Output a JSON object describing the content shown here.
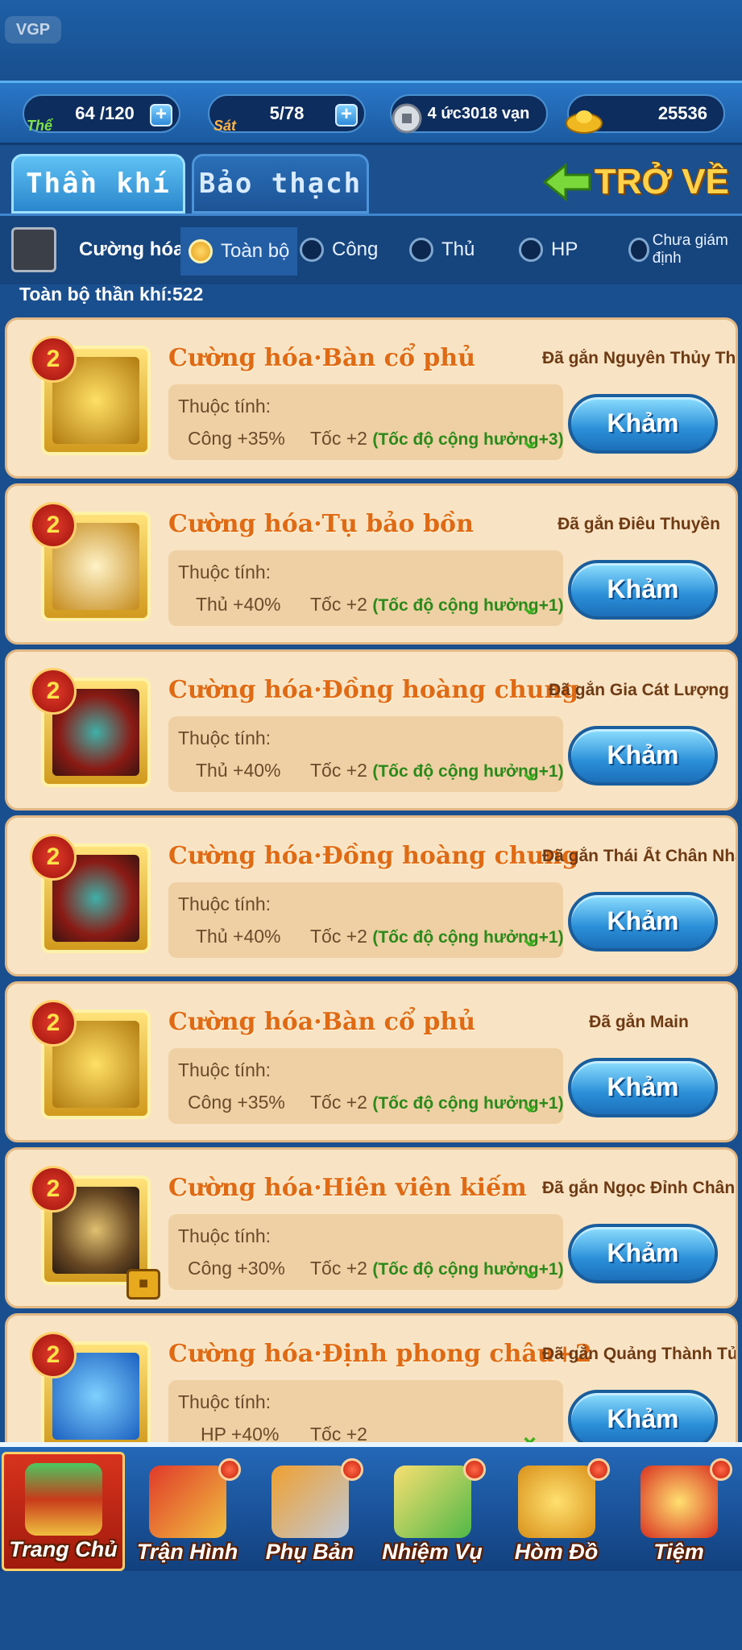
{
  "colors": {
    "accent": "#2a8fd8",
    "card_bg": "#f8e4c4",
    "title_orange": "#e06a14",
    "badge_red": "#c9200a"
  },
  "logo": {
    "text": "VGP",
    "icon": "vgp-logo-icon"
  },
  "resources": [
    {
      "icon": "stamina-icon",
      "label": "Thể",
      "value": "64 /120",
      "has_plus": true
    },
    {
      "icon": "sword-icon",
      "label": "Sát",
      "value": "5/78",
      "has_plus": true
    },
    {
      "icon": "silver-coin-icon",
      "label": "",
      "value": "4 ức3018 vạn",
      "has_plus": false
    },
    {
      "icon": "gold-ingot-icon",
      "label": "",
      "value": "25536",
      "has_plus": false
    }
  ],
  "tabs": [
    {
      "label": "Thần khí",
      "active": true
    },
    {
      "label": "Bảo thạch",
      "active": false
    }
  ],
  "back_button": {
    "label": "TRỞ VỀ",
    "icon": "back-arrow-icon"
  },
  "filter": {
    "checkbox_label": "Cường hóa",
    "options": [
      {
        "label": "Toàn bộ",
        "selected": true
      },
      {
        "label": "Công",
        "selected": false
      },
      {
        "label": "Thủ",
        "selected": false
      },
      {
        "label": "HP",
        "selected": false
      },
      {
        "label": "Chưa giám định",
        "selected": false
      }
    ]
  },
  "summary": "Toàn bộ thần khí:522",
  "attr_label": "Thuộc tính:",
  "inlay_label": "Khảm",
  "items": [
    {
      "level": "2",
      "title": "Cường hóa·Bàn cổ phủ",
      "equipped": "Đã gắn Nguyên Thủy Thiên Tô",
      "stat": "Công +35%",
      "speed": "Tốc +2",
      "resonance": "(Tốc độ cộng hưởng+3)",
      "locked": false
    },
    {
      "level": "2",
      "title": "Cường hóa·Tụ bảo bồn",
      "equipped": "Đã gắn Điêu Thuyền",
      "stat": "Thủ +40%",
      "speed": "Tốc +2",
      "resonance": "(Tốc độ cộng hưởng+1)",
      "locked": false
    },
    {
      "level": "2",
      "title": "Cường hóa·Đồng hoàng chung",
      "equipped": "Đã gắn Gia Cát Lượng",
      "stat": "Thủ +40%",
      "speed": "Tốc +2",
      "resonance": "(Tốc độ cộng hưởng+1)",
      "locked": false
    },
    {
      "level": "2",
      "title": "Cường hóa·Đồng hoàng chung",
      "equipped": "Đã gắn Thái Ất Chân Nhân",
      "stat": "Thủ +40%",
      "speed": "Tốc +2",
      "resonance": "(Tốc độ cộng hưởng+1)",
      "locked": false
    },
    {
      "level": "2",
      "title": "Cường hóa·Bàn cổ phủ",
      "equipped": "Đã gắn Main",
      "stat": "Công +35%",
      "speed": "Tốc +2",
      "resonance": "(Tốc độ cộng hưởng+1)",
      "locked": false
    },
    {
      "level": "2",
      "title": "Cường hóa·Hiên viên kiếm",
      "equipped": "Đã gắn Ngọc Đỉnh Chân Nhâ",
      "stat": "Công +30%",
      "speed": "Tốc +2",
      "resonance": "(Tốc độ cộng hưởng+1)",
      "locked": true
    },
    {
      "level": "2",
      "title": "Cường hóa·Định phong châu+2",
      "equipped": "Đã gắn Quảng Thành Tử",
      "stat": "HP +40%",
      "speed": "Tốc +2",
      "resonance": "",
      "locked": false
    }
  ],
  "nav": [
    {
      "label": "Trang Chủ",
      "icon": "palace-icon",
      "active": true,
      "badge": false
    },
    {
      "label": "Trận Hình",
      "icon": "war-banner-icon",
      "active": false,
      "badge": true
    },
    {
      "label": "Phụ Bản",
      "icon": "crossed-swords-icon",
      "active": false,
      "badge": true
    },
    {
      "label": "Nhiệm Vụ",
      "icon": "scroll-icon",
      "active": false,
      "badge": true
    },
    {
      "label": "Hòm Đồ",
      "icon": "treasure-bag-icon",
      "active": false,
      "badge": true
    },
    {
      "label": "Tiệm",
      "icon": "coins-icon",
      "active": false,
      "badge": true
    }
  ]
}
